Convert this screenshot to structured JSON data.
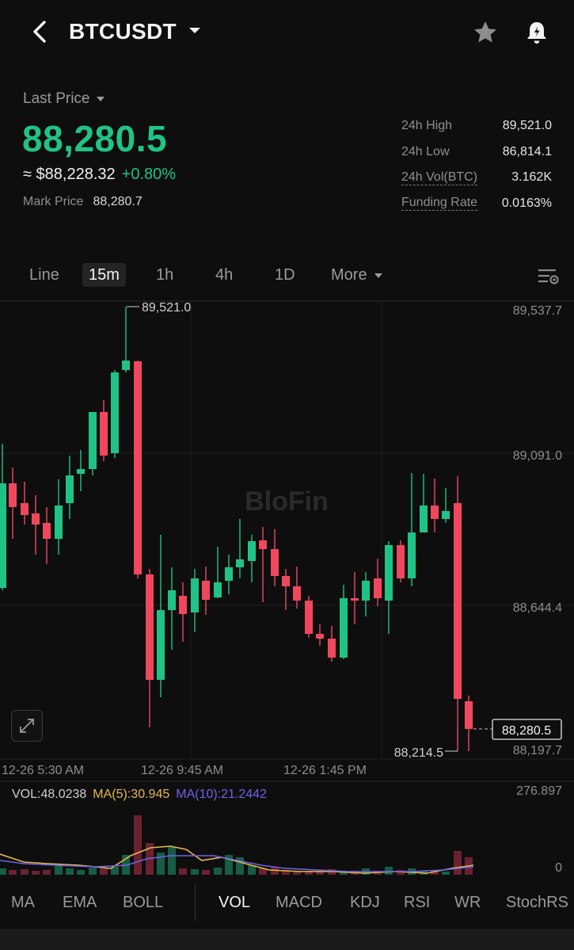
{
  "header": {
    "symbol": "BTCUSDT"
  },
  "price": {
    "label": "Last Price",
    "last": "88,280.5",
    "usd": "≈ $88,228.32",
    "change": "+0.80%",
    "mark_label": "Mark Price",
    "mark_value": "88,280.7"
  },
  "stats": [
    {
      "label": "24h High",
      "value": "89,521.0"
    },
    {
      "label": "24h Low",
      "value": "86,814.1"
    },
    {
      "label": "24h Vol(BTC)",
      "value": "3.162K"
    },
    {
      "label": "Funding Rate",
      "value": "0.0163%"
    }
  ],
  "intervals": [
    "Line",
    "15m",
    "1h",
    "4h",
    "1D",
    "More"
  ],
  "chart": {
    "watermark": "BloFin",
    "price_ticks": [
      "89,537.7",
      "89,091.0",
      "88,644.4",
      "88,197.7"
    ],
    "time_ticks": [
      "12-26 5:30 AM",
      "12-26 9:45 AM",
      "12-26 1:45 PM"
    ],
    "high_marker": "89,521.0",
    "low_marker": "88,214.5",
    "current_price_tag": "88,280.5",
    "vol_ticks": [
      "276.897",
      "0"
    ],
    "colors": {
      "up": "#20c386",
      "down": "#f0475d",
      "ma5": "#e6b94a",
      "ma10": "#6f62e8"
    }
  },
  "volume": {
    "vol": "VOL:48.0238",
    "ma5": "MA(5):30.945",
    "ma10": "MA(10):21.2442"
  },
  "indicators": {
    "main": [
      "MA",
      "EMA",
      "BOLL"
    ],
    "sub": [
      "VOL",
      "MACD",
      "KDJ",
      "RSI",
      "WR",
      "StochRS"
    ]
  }
}
